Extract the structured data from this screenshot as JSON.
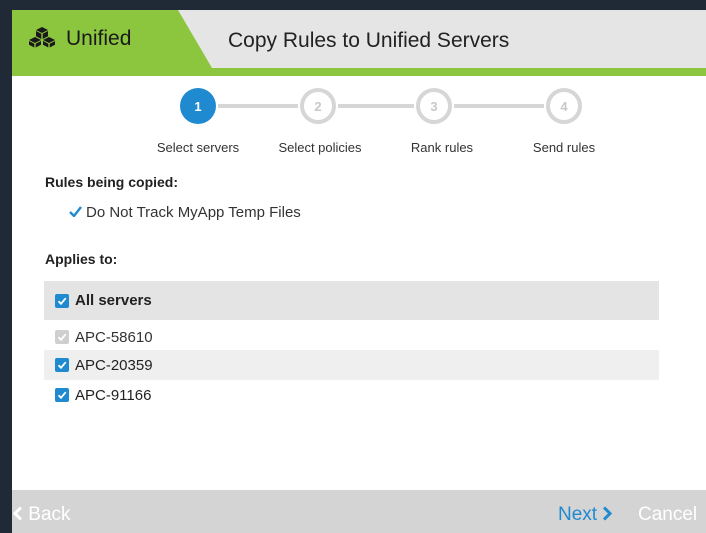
{
  "header": {
    "brand": "Unified",
    "brand_icon": "cubes-icon",
    "title": "Copy Rules to Unified Servers",
    "accent_color": "#8cc63f"
  },
  "stepper": {
    "active_color": "#1f8ad0",
    "steps": [
      {
        "number": "1",
        "label": "Select servers",
        "state": "active"
      },
      {
        "number": "2",
        "label": "Select policies",
        "state": "inactive"
      },
      {
        "number": "3",
        "label": "Rank rules",
        "state": "inactive"
      },
      {
        "number": "4",
        "label": "Send rules",
        "state": "inactive"
      }
    ]
  },
  "rules_section": {
    "heading": "Rules being copied:",
    "rules": [
      "Do Not Track MyApp Temp Files"
    ],
    "rule_icon": "checkmark-icon"
  },
  "applies_section": {
    "heading": "Applies to:",
    "all_servers": {
      "label": "All servers",
      "checked": true
    },
    "servers": [
      {
        "name": "APC-58610",
        "checked": true,
        "disabled": true
      },
      {
        "name": "APC-20359",
        "checked": true,
        "disabled": false
      },
      {
        "name": "APC-91166",
        "checked": true,
        "disabled": false
      }
    ]
  },
  "footer": {
    "back_label": "Back",
    "back_icon": "chevron-left-icon",
    "next_label": "Next",
    "next_icon": "chevron-right-icon",
    "cancel_label": "Cancel"
  }
}
